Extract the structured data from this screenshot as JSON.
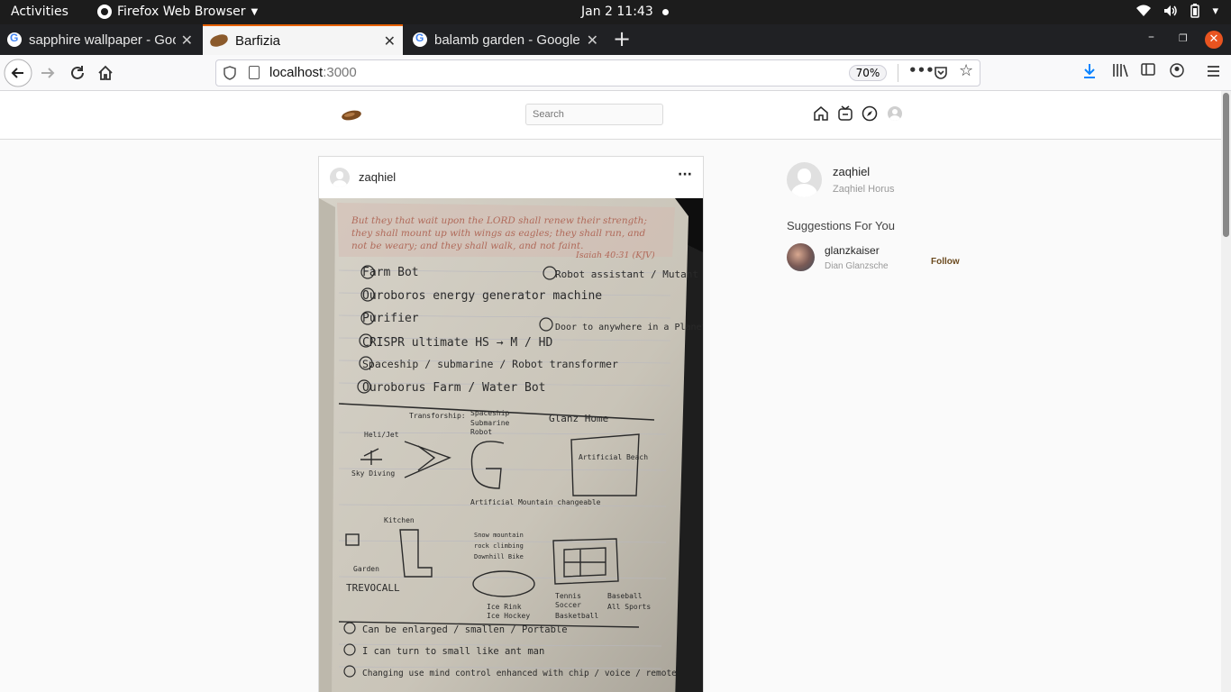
{
  "topbar": {
    "activities": "Activities",
    "app_name": "Firefox Web Browser",
    "clock": "Jan 2  11:43"
  },
  "tabs": [
    {
      "title": "sapphire wallpaper - Google",
      "active": false
    },
    {
      "title": "Barfizia",
      "active": true
    },
    {
      "title": "balamb garden - Google",
      "active": false
    }
  ],
  "navbar": {
    "url_host": "localhost",
    "url_port": ":3000",
    "zoom": "70%"
  },
  "app": {
    "search_placeholder": "Search",
    "post": {
      "username": "zaqhiel",
      "notebook_quote": "But they that wait upon the LORD shall renew their strength; they shall mount up with wings as eagles; they shall run, and not be weary; and they shall walk, and not faint.",
      "notebook_ref": "Isaiah 40:31 (KJV)",
      "notebook_lines": [
        "Farm Bot",
        "Ouroboros energy generator machine",
        "Purifier",
        "CRISPR ultimate HS → M / HD",
        "Spaceship / submarine / Robot transformer",
        "Ouroborus Farm / Water Bot",
        "Robot assistant / Mutant",
        "Door to anywhere in a Planet"
      ],
      "notebook_sketch_labels": [
        "Transforship:",
        "Spaceship",
        "Submarine",
        "Robot",
        "Glanz Home",
        "Heli/Jet",
        "Sky Diving",
        "Artificial Mountain changeable",
        "Snow mountain",
        "rock climbing",
        "Downhill Bike",
        "Artificial Beach",
        "Kitchen",
        "Garden",
        "TREVOCALL",
        "Ice Rink",
        "Ice Hockey",
        "Tennis",
        "Soccer",
        "Basketball",
        "Baseball",
        "All Sports"
      ],
      "notebook_footer": [
        "Can be enlarged / smallen / Portable",
        "I can turn to small like ant man",
        "Changing use mind control enhanced with chip / voice / remote"
      ]
    },
    "profile": {
      "username": "zaqhiel",
      "full_name": "Zaqhiel Horus"
    },
    "suggestions_title": "Suggestions For You",
    "suggestions": [
      {
        "username": "glanzkaiser",
        "full_name": "Dian Glanzsche",
        "action": "Follow"
      }
    ]
  }
}
